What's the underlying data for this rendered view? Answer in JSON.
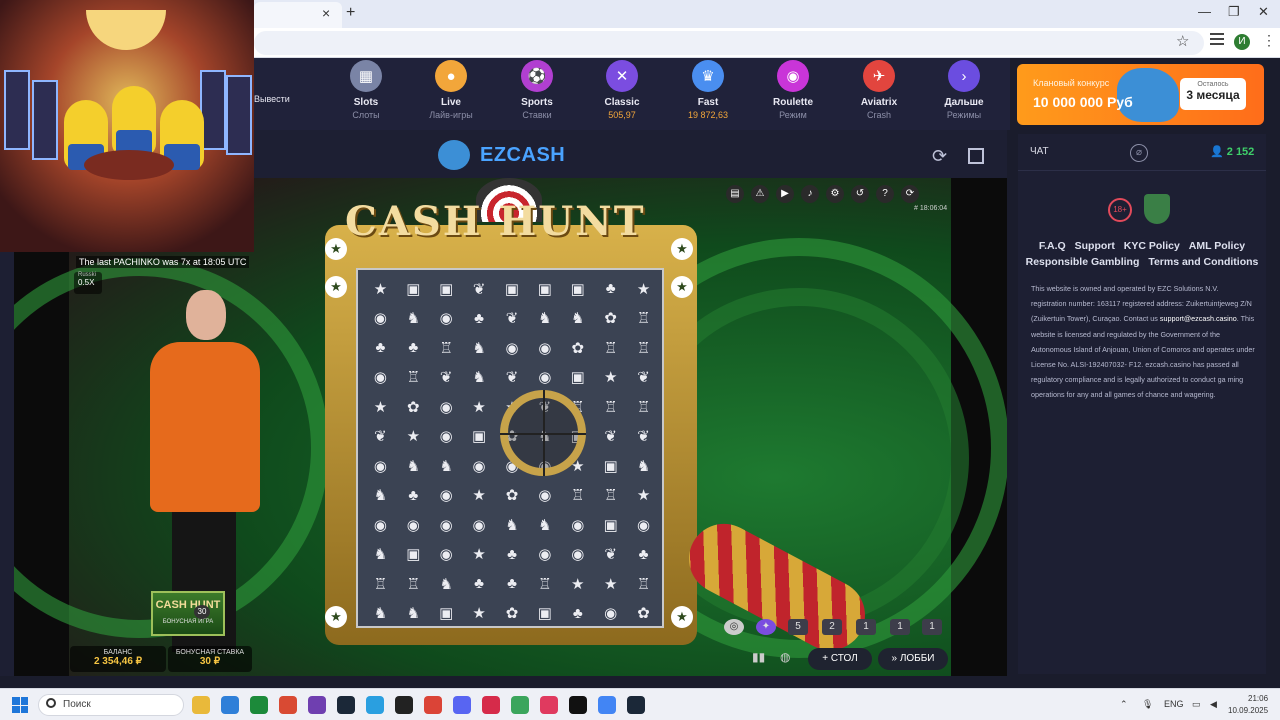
{
  "browser": {
    "tab_close": "×",
    "new_tab": "+",
    "window_controls": [
      "—",
      "❐",
      "✕"
    ],
    "address_icons": [
      "star-icon",
      "list-icon",
      "profile-icon",
      "menu-icon"
    ],
    "profile_initial": "И"
  },
  "nav": {
    "withdraw": "Вывести",
    "items": [
      {
        "title": "Slots",
        "sub": "Слоты",
        "color": "#7a84a6",
        "icon": "▦"
      },
      {
        "title": "Live",
        "sub": "Лайв-игры",
        "color": "#f2a63a",
        "icon": "●"
      },
      {
        "title": "Sports",
        "sub": "Ставки",
        "color": "#b13fd1",
        "icon": "⚽"
      },
      {
        "title": "Classic",
        "sub": "505,97",
        "color": "#7b4de0",
        "icon": "✕"
      },
      {
        "title": "Fast",
        "sub": "19 872,63",
        "color": "#4a8ef0",
        "icon": "♛"
      },
      {
        "title": "Roulette",
        "sub": "Режим",
        "color": "#c935d8",
        "icon": "◉"
      },
      {
        "title": "Aviatrix",
        "sub": "Crash",
        "color": "#e2453e",
        "icon": "✈"
      },
      {
        "title": "Дальше",
        "sub": "Режимы",
        "color": "#6b4de0",
        "icon": "›"
      }
    ]
  },
  "promo": {
    "title": "Клановый конкурс",
    "amount": "10 000 000 Руб",
    "left_label": "Осталось",
    "months": "3 месяца"
  },
  "logo": {
    "text": "EZCASH"
  },
  "game": {
    "title": "CASH HUNT",
    "last_result": "The last PACHINKO was 7x at 18:05 UTC",
    "lang_name": "Russki",
    "lang_value": "0.5X",
    "round_id": "# 18:06:04",
    "bonus_game_title": "CASH HUNT",
    "bonus_game_sub": "БОНУСНАЯ ИГРА",
    "bonus_count": "30",
    "balance_label": "БАЛАНС",
    "balance_value": "2 354,46 ₽",
    "bonus_bet_label": "БОНУСНАЯ СТАВКА",
    "bonus_bet_value": "30 ₽",
    "history": [
      "5",
      "2",
      "1",
      "1",
      "1"
    ],
    "table_button": "+ СТОЛ",
    "lobby_button": "» ЛОББИ",
    "grid_symbols": [
      "★",
      "▣",
      "▣",
      "❦",
      "▣",
      "▣",
      "▣",
      "♣",
      "★",
      "◉",
      "♞",
      "◉",
      "♣",
      "❦",
      "♞",
      "♞",
      "✿",
      "♖",
      "♣",
      "♣",
      "♖",
      "♞",
      "◉",
      "◉",
      "✿",
      "♖",
      "♖",
      "◉",
      "♖",
      "❦",
      "♞",
      "❦",
      "◉",
      "▣",
      "★",
      "❦",
      "★",
      "✿",
      "◉",
      "★",
      "★",
      "❦",
      "♖",
      "♖",
      "♖",
      "❦",
      "★",
      "◉",
      "▣",
      "✿",
      "♞",
      "▣",
      "❦",
      "❦",
      "◉",
      "♞",
      "♞",
      "◉",
      "◉",
      "◉",
      "★",
      "▣",
      "♞",
      "♞",
      "♣",
      "◉",
      "★",
      "✿",
      "◉",
      "♖",
      "♖",
      "★",
      "◉",
      "◉",
      "◉",
      "◉",
      "♞",
      "♞",
      "◉",
      "▣",
      "◉",
      "♞",
      "▣",
      "◉",
      "★",
      "♣",
      "◉",
      "◉",
      "❦",
      "♣",
      "♖",
      "♖",
      "♞",
      "♣",
      "♣",
      "♖",
      "★",
      "★",
      "♖",
      "♞",
      "♞",
      "▣",
      "★",
      "✿",
      "▣",
      "♣",
      "◉",
      "✿"
    ]
  },
  "chat": {
    "label": "ЧАТ",
    "online": "2 152",
    "age": "18+"
  },
  "footer_links": [
    "F.A.Q",
    "Support",
    "KYC Policy",
    "AML Policy",
    "Responsible Gambling",
    "Terms and Conditions"
  ],
  "legal": {
    "before_email": "This website is owned and operated by EZC Solutions N.V. registration number: 163117 registered address: Zuikertuintjeweg Z/N (Zuikertuin Tower), Curaçao. Contact us ",
    "email": "support@ezcash.casino",
    "after_email": ". This website is licensed and regulated by the Government of the Autonomous Island of Anjouan, Union of Comoros and operates under License No. ALSI-192407032- F12. ezcash.casino has passed all regulatory compliance and is legally authorized to conduct ga ming operations for any and all games of chance and wagering."
  },
  "taskbar": {
    "search_placeholder": "Поиск",
    "lang": "ENG",
    "time": "21:06",
    "date": "10.09.2025",
    "apps": [
      "#e9b93a",
      "#2f7fd8",
      "#1c8a3a",
      "#d94a33",
      "#6f3fb0",
      "#1b2838",
      "#2a9fe0",
      "#222222",
      "#db4437",
      "#5865f2",
      "#d62b4a",
      "#3ba55c",
      "#e03a5f",
      "#111111",
      "#4285f4",
      "#1b2838"
    ]
  }
}
